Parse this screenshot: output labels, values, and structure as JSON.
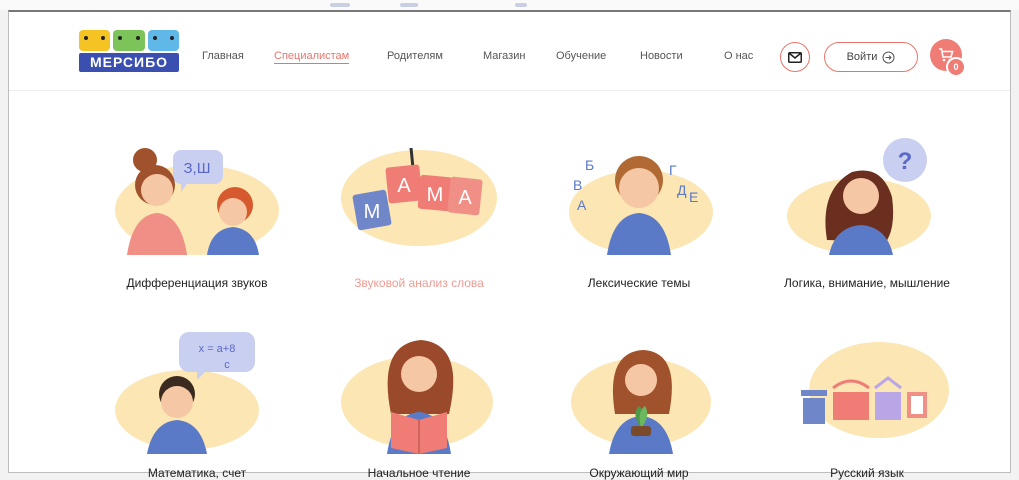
{
  "brand": {
    "name": "МЕРСИБО"
  },
  "nav": {
    "items": [
      {
        "label": "Главная",
        "active": false
      },
      {
        "label": "Специалистам",
        "active": true
      },
      {
        "label": "Родителям",
        "active": false
      },
      {
        "label": "Магазин",
        "active": false
      },
      {
        "label": "Обучение",
        "active": false
      },
      {
        "label": "Новости",
        "active": false
      },
      {
        "label": "О нас",
        "active": false
      }
    ]
  },
  "header": {
    "login_label": "Войти",
    "cart_count": "0"
  },
  "categories": [
    {
      "label": "Дифференциация звуков",
      "active": false,
      "bubble": "З,Ш"
    },
    {
      "label": "Звуковой анализ слова",
      "active": true,
      "letters": [
        "М",
        "А",
        "М",
        "А"
      ]
    },
    {
      "label": "Лексические темы",
      "active": false,
      "letters": [
        "Б",
        "В",
        "А",
        "Г",
        "Д",
        "Е"
      ]
    },
    {
      "label": "Логика, внимание, мышление",
      "active": false,
      "bubble": "?"
    },
    {
      "label": "Математика, счет",
      "active": false,
      "bubble_top": "x = a+8",
      "bubble_bottom": "c"
    },
    {
      "label": "Начальное чтение",
      "active": false
    },
    {
      "label": "Окружающий мир",
      "active": false
    },
    {
      "label": "Русский язык",
      "active": false
    }
  ],
  "colors": {
    "accent": "#e8756c",
    "blob": "#fbe6b4",
    "brand_blue": "#3a4fb0"
  }
}
